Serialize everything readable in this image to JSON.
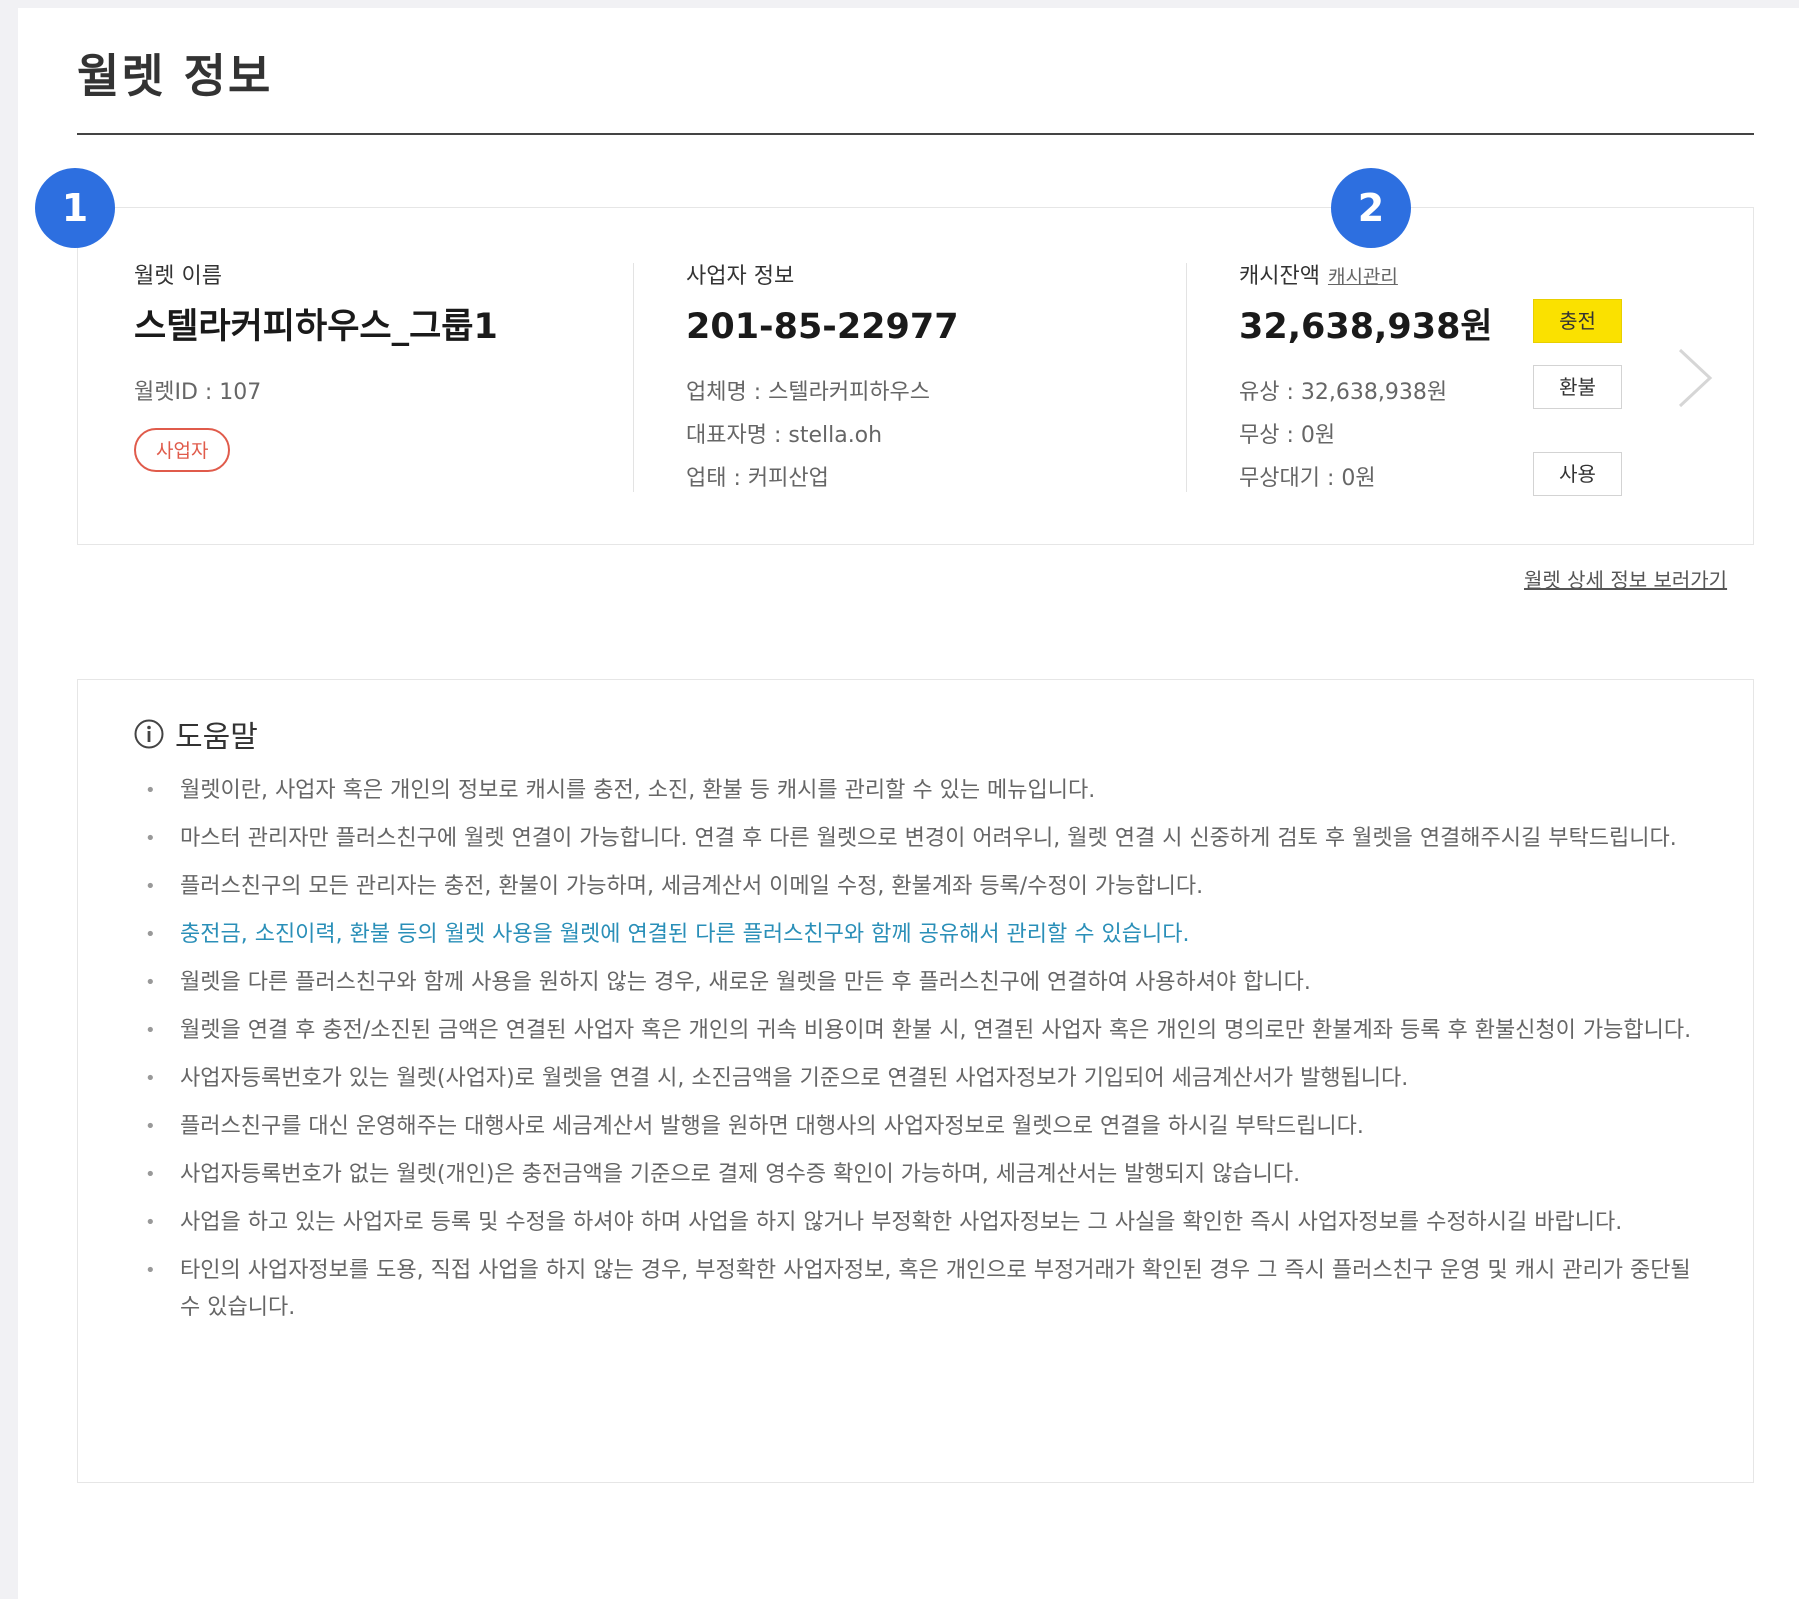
{
  "page": {
    "title": "월렛 정보"
  },
  "wallet": {
    "name_label": "월렛 이름",
    "name": "스텔라커피하우스_그룹1",
    "id_text": "월렛ID : 107",
    "type_badge": "사업자"
  },
  "business": {
    "label": "사업자 정보",
    "number": "201-85-22977",
    "company": "업체명 : 스텔라커피하우스",
    "ceo": "대표자명 : stella.oh",
    "category": "업태 : 커피산업"
  },
  "cash": {
    "label": "캐시잔액",
    "manage_link": "캐시관리",
    "balance": "32,638,938원",
    "paid": "유상 : 32,638,938원",
    "free": "무상 : 0원",
    "free_pending": "무상대기 : 0원",
    "buttons": {
      "charge": "충전",
      "refund": "환불",
      "use": "사용"
    }
  },
  "detail_link": "월렛 상세 정보 보러가기",
  "help": {
    "title": "도움말",
    "items": [
      "월렛이란, 사업자 혹은 개인의 정보로 캐시를 충전, 소진, 환불 등 캐시를 관리할 수 있는 메뉴입니다.",
      "마스터 관리자만 플러스친구에 월렛 연결이 가능합니다. 연결 후 다른 월렛으로 변경이 어려우니, 월렛 연결 시 신중하게 검토 후 월렛을 연결해주시길 부탁드립니다.",
      "플러스친구의 모든 관리자는 충전, 환불이 가능하며, 세금계산서 이메일 수정, 환불계좌 등록/수정이 가능합니다.",
      "충전금, 소진이력, 환불 등의 월렛 사용을 월렛에 연결된 다른 플러스친구와 함께 공유해서 관리할 수 있습니다.",
      "월렛을 다른 플러스친구와 함께 사용을 원하지 않는 경우, 새로운 월렛을 만든 후 플러스친구에 연결하여 사용하셔야 합니다.",
      "월렛을 연결 후 충전/소진된 금액은 연결된 사업자 혹은 개인의 귀속 비용이며 환불 시, 연결된 사업자 혹은 개인의 명의로만 환불계좌 등록 후 환불신청이 가능합니다.",
      "사업자등록번호가 있는 월렛(사업자)로 월렛을 연결 시, 소진금액을 기준으로 연결된 사업자정보가 기입되어 세금계산서가 발행됩니다.",
      "플러스친구를 대신 운영해주는 대행사로 세금계산서 발행을 원하면 대행사의 사업자정보로 월렛으로 연결을 하시길 부탁드립니다.",
      "사업자등록번호가 없는 월렛(개인)은 충전금액을 기준으로 결제 영수증 확인이 가능하며, 세금계산서는 발행되지 않습니다.",
      "사업을 하고 있는 사업자로 등록 및 수정을 하셔야 하며 사업을 하지 않거나 부정확한 사업자정보는 그 사실을 확인한 즉시 사업자정보를 수정하시길 바랍니다.",
      "타인의 사업자정보를 도용, 직접 사업을 하지 않는 경우, 부정확한 사업자정보, 혹은 개인으로 부정거래가 확인된 경우 그 즉시 플러스친구 운영 및 캐시 관리가 중단될 수 있습니다."
    ]
  },
  "markers": {
    "one": "1",
    "two": "2"
  },
  "colors": {
    "accent_yellow": "#fae100",
    "badge_red": "#e05b4b",
    "marker_blue": "#2d6fe0",
    "highlight_text": "#2a8fb8"
  }
}
